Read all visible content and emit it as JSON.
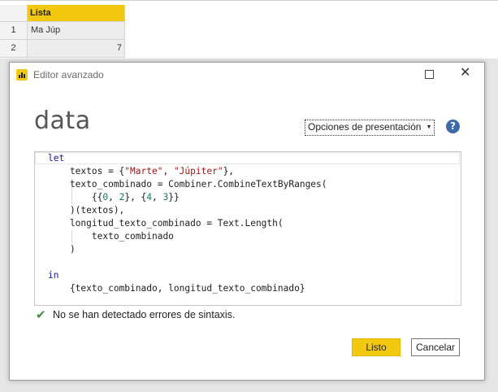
{
  "spreadsheet": {
    "column_header": "Lista",
    "rows": [
      {
        "number": "1",
        "value": "Ma Júp"
      },
      {
        "number": "2",
        "value": "7"
      }
    ]
  },
  "dialog": {
    "title": "Editor avanzado",
    "query_name": "data",
    "display_options_label": "Opciones de presentación",
    "help_glyph": "?",
    "code_lines": [
      "let",
      "    textos = {\"Marte\", \"Júpiter\"},",
      "    texto_combinado = Combiner.CombineTextByRanges(",
      "        {{0, 2}, {4, 3}}",
      "    )(textos),",
      "    longitud_texto_combinado = Text.Length(",
      "        texto_combinado",
      "    )",
      "",
      "in",
      "    {texto_combinado, longitud_texto_combinado}"
    ],
    "status_text": "No se han detectado errores de sintaxis.",
    "done_label": "Listo",
    "cancel_label": "Cancelar"
  },
  "colors": {
    "accent": "#f2c811",
    "help": "#3d6aa8",
    "ok_check": "#3a8f3a",
    "keyword": "#1a1aa6",
    "string": "#a31515",
    "number": "#098658"
  },
  "icons": [
    "power-bi-app-icon",
    "maximize-icon",
    "close-icon",
    "dropdown-caret-icon",
    "help-icon",
    "checkmark-icon"
  ]
}
